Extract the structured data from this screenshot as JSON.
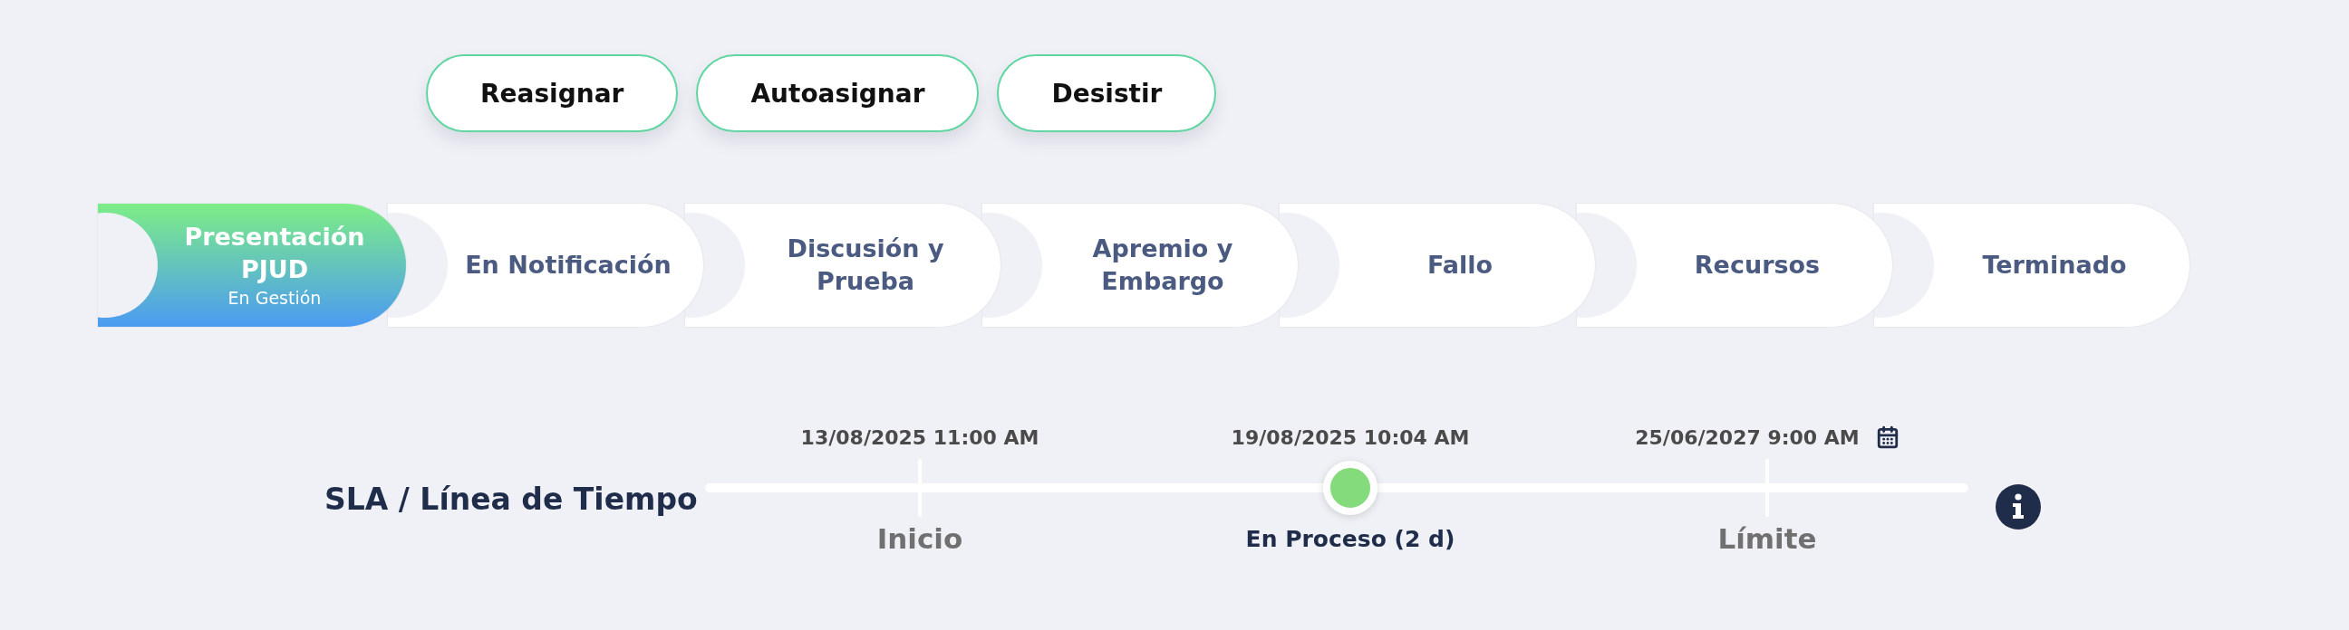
{
  "actions": [
    {
      "label": "Reasignar"
    },
    {
      "label": "Autoasignar"
    },
    {
      "label": "Desistir"
    }
  ],
  "stages": [
    {
      "label": "Presentación PJUD",
      "status": "En Gestión",
      "selected": true
    },
    {
      "label": "En Notificación",
      "selected": false
    },
    {
      "label": "Discusión y Prueba",
      "selected": false
    },
    {
      "label": "Apremio y Embargo",
      "selected": false
    },
    {
      "label": "Fallo",
      "selected": false
    },
    {
      "label": "Recursos",
      "selected": false
    },
    {
      "label": "Terminado",
      "selected": false
    }
  ],
  "timeline": {
    "title": "SLA / Línea de Tiempo",
    "markers": [
      {
        "kind": "tick",
        "date": "13/08/2025 11:00 AM",
        "label": "Inicio"
      },
      {
        "kind": "current",
        "date": "19/08/2025 10:04 AM",
        "label": "En Proceso (2 d)"
      },
      {
        "kind": "deadline",
        "date": "25/06/2027 9:00 AM",
        "label": "Límite"
      }
    ]
  }
}
